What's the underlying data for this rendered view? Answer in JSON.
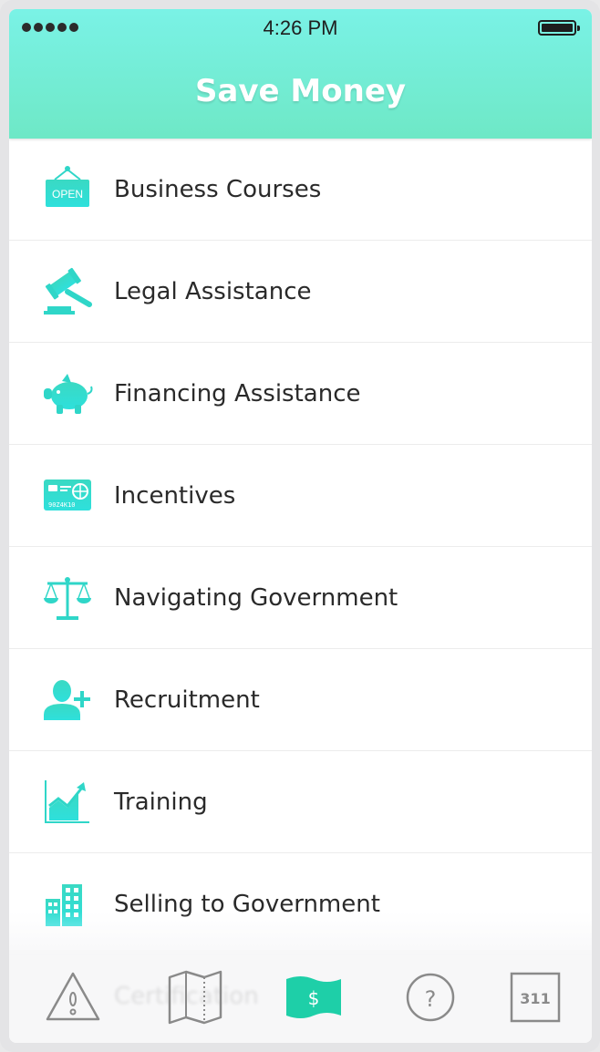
{
  "status_bar": {
    "time": "4:26 PM"
  },
  "header": {
    "title": "Save Money"
  },
  "menu": {
    "items": [
      {
        "label": "Business Courses",
        "icon": "open-sign-icon"
      },
      {
        "label": "Legal Assistance",
        "icon": "gavel-icon"
      },
      {
        "label": "Financing Assistance",
        "icon": "piggy-bank-icon"
      },
      {
        "label": "Incentives",
        "icon": "credit-card-icon"
      },
      {
        "label": "Navigating Government",
        "icon": "scales-icon"
      },
      {
        "label": "Recruitment",
        "icon": "add-person-icon"
      },
      {
        "label": "Training",
        "icon": "growth-chart-icon"
      },
      {
        "label": "Selling to Government",
        "icon": "buildings-icon"
      },
      {
        "label": "Certification",
        "icon": ""
      }
    ]
  },
  "icon_labels": {
    "open_sign": "OPEN",
    "card_digits": "90Z4K10"
  },
  "tab_bar": {
    "tabs": [
      {
        "name": "alerts",
        "icon": "warning-icon"
      },
      {
        "name": "map",
        "icon": "map-icon"
      },
      {
        "name": "save-money",
        "icon": "dollar-bill-icon",
        "active": true,
        "glyph": "$"
      },
      {
        "name": "help",
        "icon": "question-icon",
        "glyph": "?"
      },
      {
        "name": "311",
        "icon": "311-icon",
        "glyph": "311"
      }
    ]
  },
  "colors": {
    "accent_top": "#7af2e6",
    "accent_bottom": "#6ee8c6",
    "icon_teal": "#2fd6c8",
    "active_tab": "#1ecfa8",
    "inactive_tab": "#8a8a8a",
    "text": "#2a2a2a"
  }
}
